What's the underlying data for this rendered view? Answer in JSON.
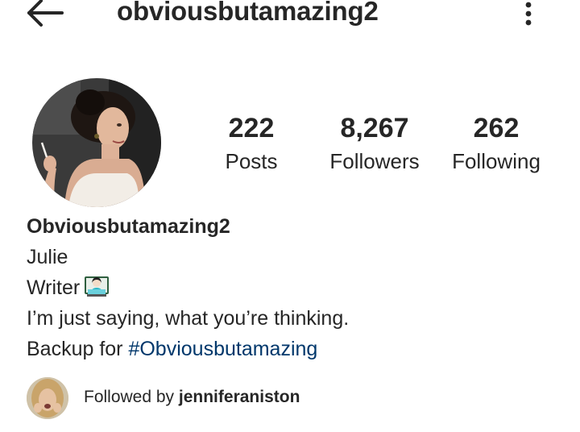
{
  "header": {
    "back_icon": "arrow-left-icon",
    "username": "obviousbutamazing2",
    "more_icon": "more-vertical-icon"
  },
  "profile": {
    "avatar_icon": "profile-photo",
    "stats": {
      "posts_count": "222",
      "posts_label": "Posts",
      "followers_count": "8,267",
      "followers_label": "Followers",
      "following_count": "262",
      "following_label": "Following"
    }
  },
  "bio": {
    "display_name": "Obviousbutamazing2",
    "name": "Julie",
    "occupation": "Writer",
    "occupation_emoji": "woman-technologist-emoji",
    "tagline": "I’m just saying, what you’re thinking.",
    "backup_prefix": "Backup for ",
    "backup_hashtag": "#Obviousbutamazing"
  },
  "followed_by": {
    "prefix": "Followed by ",
    "username": "jenniferaniston",
    "avatar_icon": "follower-avatar"
  },
  "colors": {
    "text": "#262626",
    "link": "#00376b",
    "background": "#ffffff"
  }
}
